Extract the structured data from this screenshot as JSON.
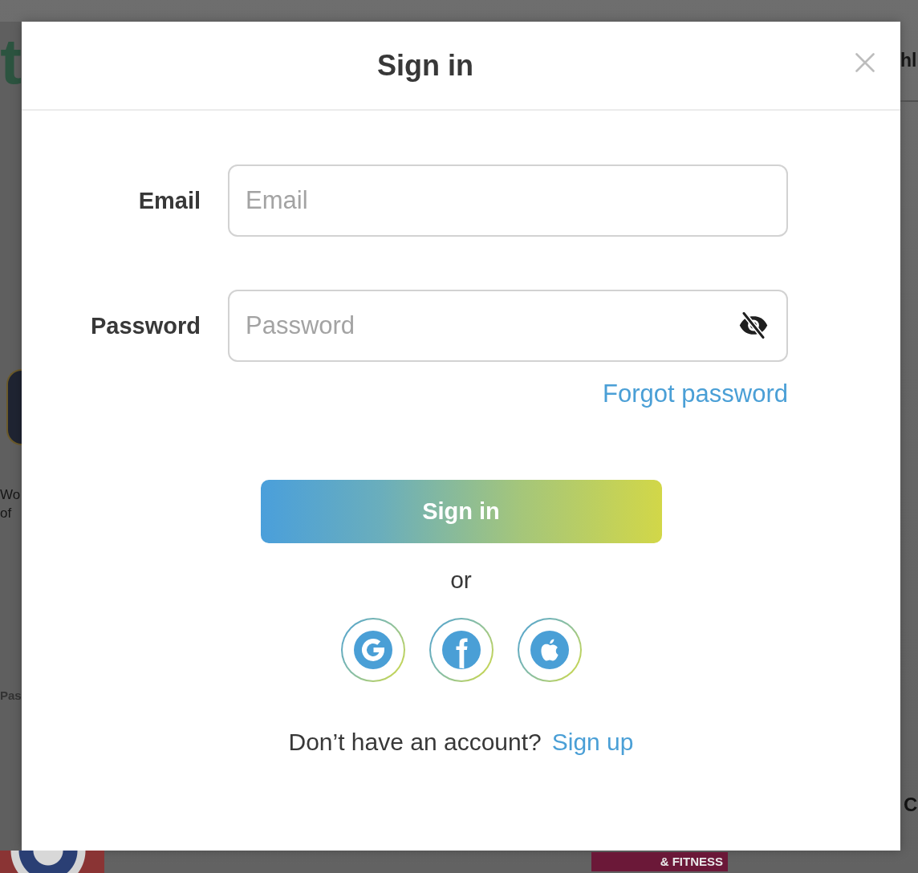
{
  "background_page": {
    "logo_fragment": "t",
    "header_fragment": "hl",
    "side_texts": [
      "Wo",
      "of"
    ],
    "side_heading": "Pas",
    "banner": "& FITNESS",
    "corner_text": "C"
  },
  "dialog": {
    "title": "Sign in",
    "fields": [
      {
        "kind": "email",
        "label": "Email",
        "placeholder": "Email"
      },
      {
        "kind": "password",
        "label": "Password",
        "placeholder": "Password",
        "shown": false
      }
    ],
    "forgot_link": "Forgot password",
    "submit_button": "Sign in",
    "separator": "or",
    "social_buttons": [
      {
        "kind": "google"
      },
      {
        "kind": "facebook"
      },
      {
        "kind": "apple"
      }
    ],
    "signup_prompt": "Don’t have an account?",
    "signup_link": "Sign up"
  }
}
